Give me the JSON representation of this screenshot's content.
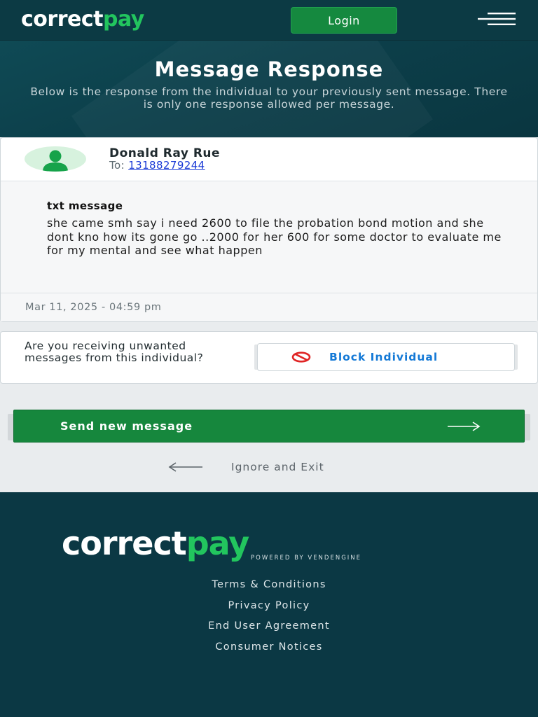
{
  "header": {
    "logo_white": "correct",
    "logo_green": "pay",
    "login_label": "Login"
  },
  "hero": {
    "title": "Message Response",
    "subtitle": "Below is the response from the individual to your previously sent message. There is only one response allowed per message."
  },
  "message": {
    "sender_name": "Donald Ray Rue",
    "to_label": "To:",
    "to_number": "13188279244",
    "type_label": "txt message",
    "text": "she came smh say i need 2600 to file the probation bond motion and she dont kno how its gone go ..2000 for her 600 for some doctor to evaluate me for my mental and see what happen",
    "timestamp": "Mar 11, 2025 - 04:59 pm"
  },
  "block": {
    "question": "Are you receiving unwanted messages from this individual?",
    "button_label": "Block Individual",
    "accent_color": "#1479d6",
    "icon": "prohibited-icon",
    "icon_color": "#e02424"
  },
  "actions": {
    "send_label": "Send new message",
    "ignore_label": "Ignore and Exit",
    "send_color": "#16873d"
  },
  "footer": {
    "logo_white": "correct",
    "logo_green": "pay",
    "powered_by": "POWERED BY VENDENGINE",
    "links": [
      "Terms & Conditions",
      "Privacy Policy",
      "End User Agreement",
      "Consumer Notices"
    ]
  },
  "colors": {
    "brand_dark": "#0c3a44",
    "brand_green": "#22c55e"
  }
}
